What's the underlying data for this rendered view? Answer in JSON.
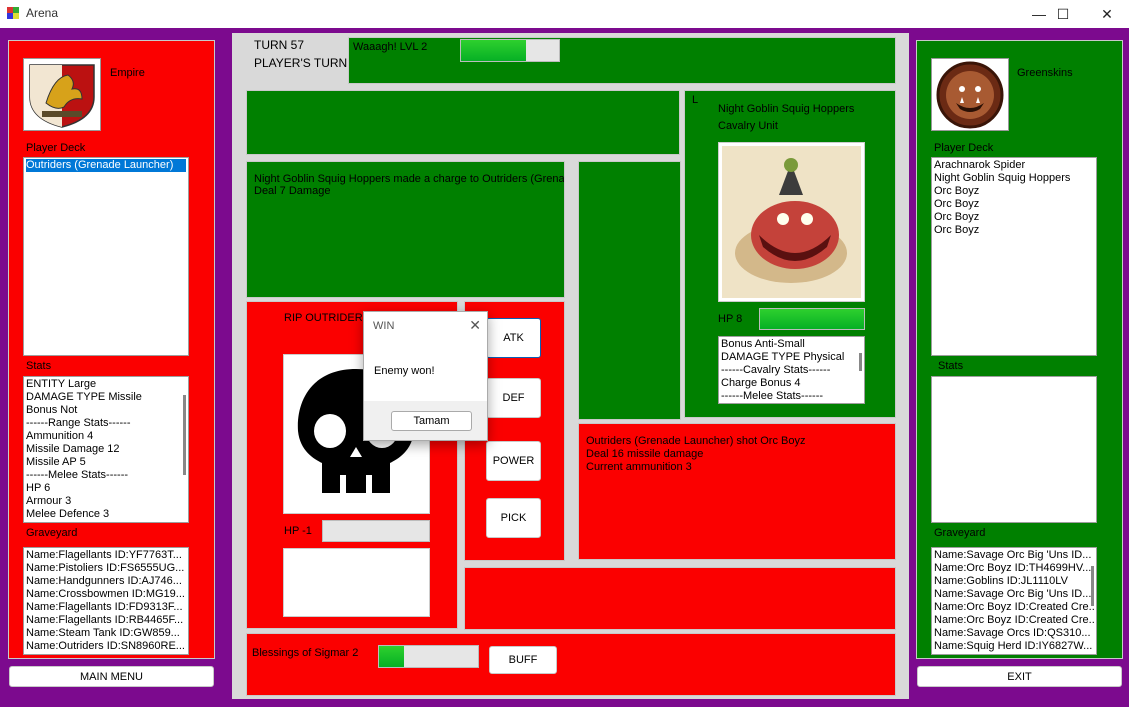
{
  "window": {
    "title": "Arena",
    "minimize": "—",
    "maximize": "☐",
    "close": "✕"
  },
  "left": {
    "faction": "Empire",
    "deck_label": "Player Deck",
    "deck": [
      "Outriders (Grenade Launcher)"
    ],
    "stats_label": "Stats",
    "stats": [
      "ENTITY Large",
      "DAMAGE TYPE Missile",
      "Bonus Not",
      "------Range Stats------",
      "Ammunition 4",
      "Missile Damage 12",
      "Missile AP 5",
      "------Melee Stats------",
      "HP 6",
      "Armour 3",
      "Melee Defence 3"
    ],
    "graveyard_label": "Graveyard",
    "graveyard": [
      "Name:Flagellants ID:YF7763T...",
      "Name:Pistoliers ID:FS6555UG...",
      "Name:Handgunners ID:AJ746...",
      "Name:Crossbowmen ID:MG19...",
      "Name:Flagellants ID:FD9313F...",
      "Name:Flagellants ID:RB4465F...",
      "Name:Steam Tank ID:GW859...",
      "Name:Outriders ID:SN8960RE..."
    ],
    "main_menu": "MAIN MENU"
  },
  "right": {
    "faction": "Greenskins",
    "deck_label": "Player Deck",
    "deck": [
      "Arachnarok Spider",
      "Night Goblin Squig Hoppers",
      "Orc Boyz",
      "Orc Boyz",
      "Orc Boyz",
      "Orc Boyz"
    ],
    "stats_label": "Stats",
    "graveyard_label": "Graveyard",
    "graveyard": [
      "Name:Savage Orc Big 'Uns ID...",
      "Name:Orc Boyz ID:TH4699HV...",
      "Name:Goblins ID:JL1110LV",
      "Name:Savage Orc Big 'Uns ID...",
      "Name:Orc Boyz ID:Created Cre...",
      "Name:Orc Boyz ID:Created Cre...",
      "Name:Savage Orcs ID:QS310...",
      "Name:Squig Herd ID:IY6827W..."
    ],
    "exit": "EXIT"
  },
  "top": {
    "turn": "TURN 57",
    "player_turn": "PLAYER'S TURN",
    "waaagh": "Waaagh! LVL 2",
    "waaagh_level": 0.66
  },
  "enemy_card": {
    "corner": "L",
    "name": "Night Goblin Squig Hoppers",
    "type": "Cavalry Unit",
    "hp_label": "HP 8",
    "hp_fraction": 1.0,
    "stats": [
      "Bonus Anti-Small",
      "DAMAGE TYPE Physical",
      "------Cavalry Stats------",
      "Charge Bonus 4",
      "------Melee Stats------"
    ]
  },
  "log_left": {
    "line1": "Night Goblin Squig Hoppers made a charge to Outriders (Grenade Launcher)",
    "line2": "Deal 7 Damage"
  },
  "log_right": {
    "line1": "Outriders (Grenade Launcher) shot Orc Boyz",
    "line2": "Deal 16 missile damage",
    "line3": "Current ammunition 3"
  },
  "player_card": {
    "rip": "RIP OUTRIDERS",
    "hp_label": "HP -1",
    "hp_fraction": 0
  },
  "actions": {
    "atk": "ATK",
    "def": "DEF",
    "power": "POWER",
    "pick": "PICK"
  },
  "bottom": {
    "blessing": "Blessings of Sigmar 2",
    "blessing_level": 0.25,
    "buff": "BUFF"
  },
  "dialog": {
    "title": "WIN",
    "message": "Enemy won!",
    "ok": "Tamam",
    "close": "✕"
  },
  "colors": {
    "red": "#fb0000",
    "green": "#008000",
    "frame": "#7c0a8e"
  }
}
